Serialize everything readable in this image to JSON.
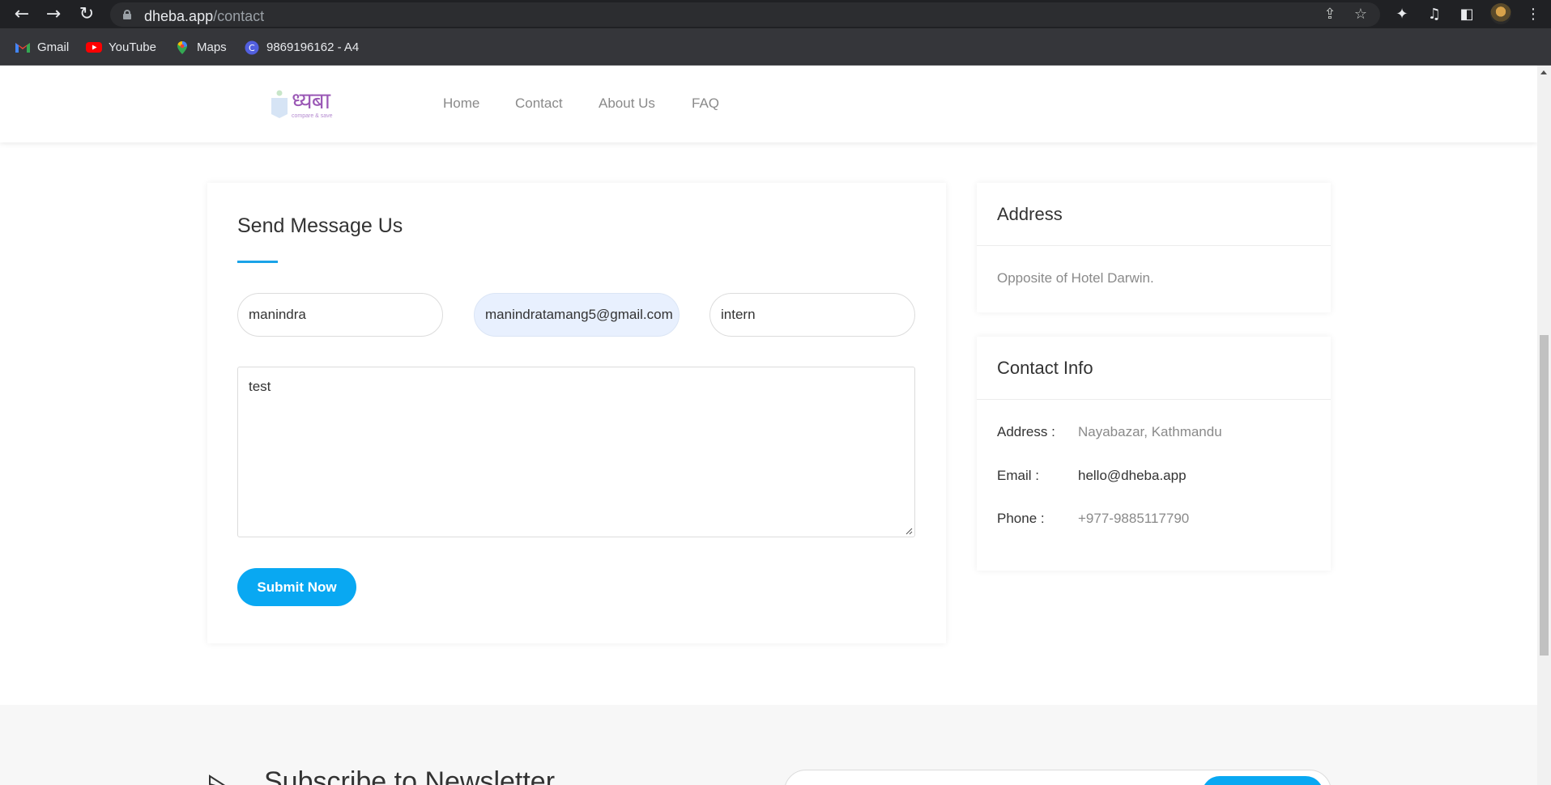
{
  "browser": {
    "url_host": "dheba.app",
    "url_path": "/contact",
    "bookmarks": [
      {
        "label": "Gmail",
        "icon": "gmail-icon"
      },
      {
        "label": "YouTube",
        "icon": "youtube-icon"
      },
      {
        "label": "Maps",
        "icon": "maps-icon"
      },
      {
        "label": "9869196162 - A4",
        "icon": "canva-icon"
      }
    ]
  },
  "site": {
    "logo_text": "ध्यबा",
    "logo_tagline": "compare & save",
    "nav": [
      "Home",
      "Contact",
      "About Us",
      "FAQ"
    ]
  },
  "form": {
    "title": "Send Message Us",
    "name_value": "manindra",
    "email_value": "manindratamang5@gmail.com",
    "subject_value": "intern",
    "message_value": "test",
    "submit_label": "Submit Now"
  },
  "address_card": {
    "title": "Address",
    "text": "Opposite of Hotel Darwin."
  },
  "contact_card": {
    "title": "Contact Info",
    "rows": [
      {
        "label": "Address :",
        "value": "Nayabazar, Kathmandu"
      },
      {
        "label": "Email :",
        "value": "hello@dheba.app"
      },
      {
        "label": "Phone :",
        "value": "+977-9885117790"
      }
    ]
  },
  "newsletter": {
    "title": "Subscribe to Newsletter"
  },
  "colors": {
    "accent": "#09a8f2",
    "chrome_bg": "#202124",
    "logo_purple": "#9b59b6"
  }
}
